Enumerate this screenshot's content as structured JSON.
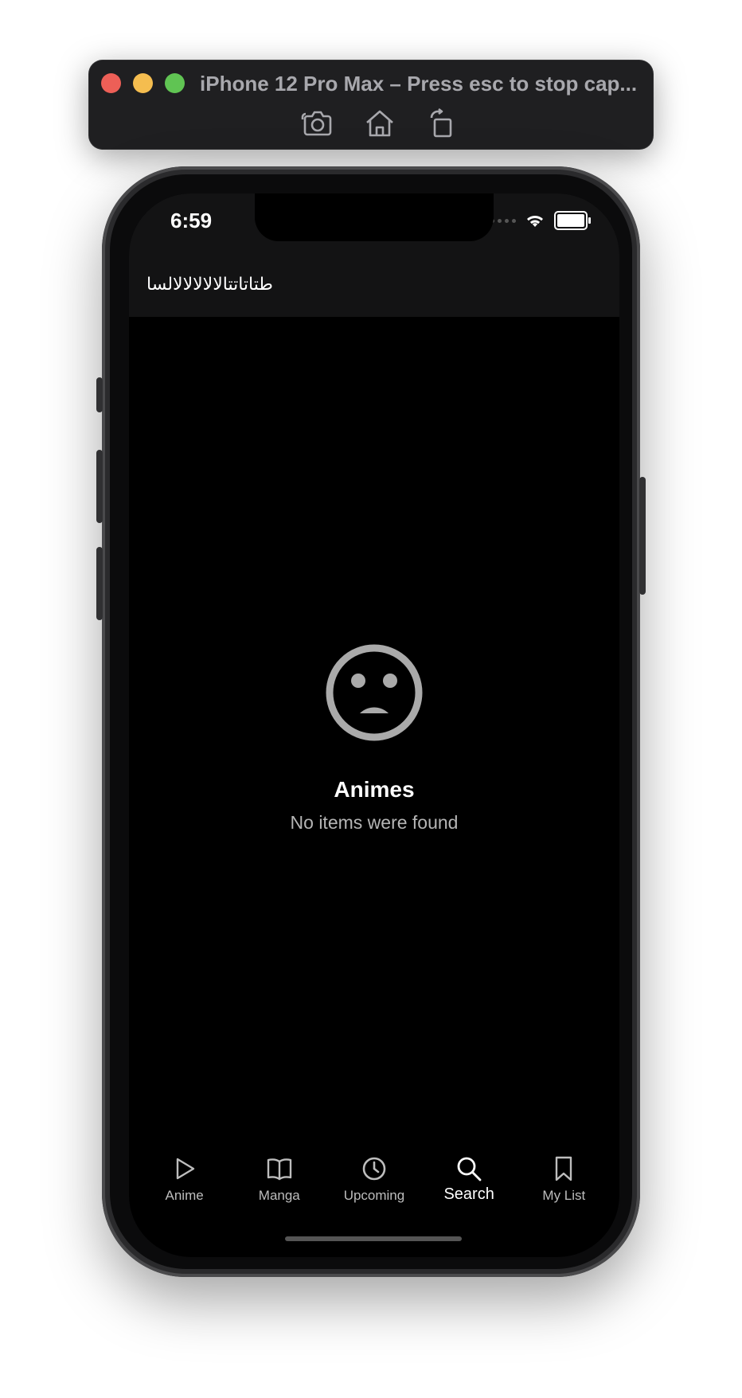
{
  "simulator": {
    "title": "iPhone 12 Pro Max – Press esc to stop cap...",
    "tools": [
      {
        "name": "screenshot-icon"
      },
      {
        "name": "home-icon"
      },
      {
        "name": "rotate-icon"
      }
    ]
  },
  "status_bar": {
    "time": "6:59"
  },
  "header": {
    "search_text": "طتاتاتتالالالالالالسا"
  },
  "empty_state": {
    "icon": "sad-face-icon",
    "title": "Animes",
    "subtitle": "No items were found"
  },
  "tabs": [
    {
      "label": "Anime",
      "icon": "play-icon",
      "active": false
    },
    {
      "label": "Manga",
      "icon": "book-icon",
      "active": false
    },
    {
      "label": "Upcoming",
      "icon": "clock-icon",
      "active": false
    },
    {
      "label": "Search",
      "icon": "search-icon",
      "active": true
    },
    {
      "label": "My List",
      "icon": "bookmark-icon",
      "active": false
    }
  ]
}
